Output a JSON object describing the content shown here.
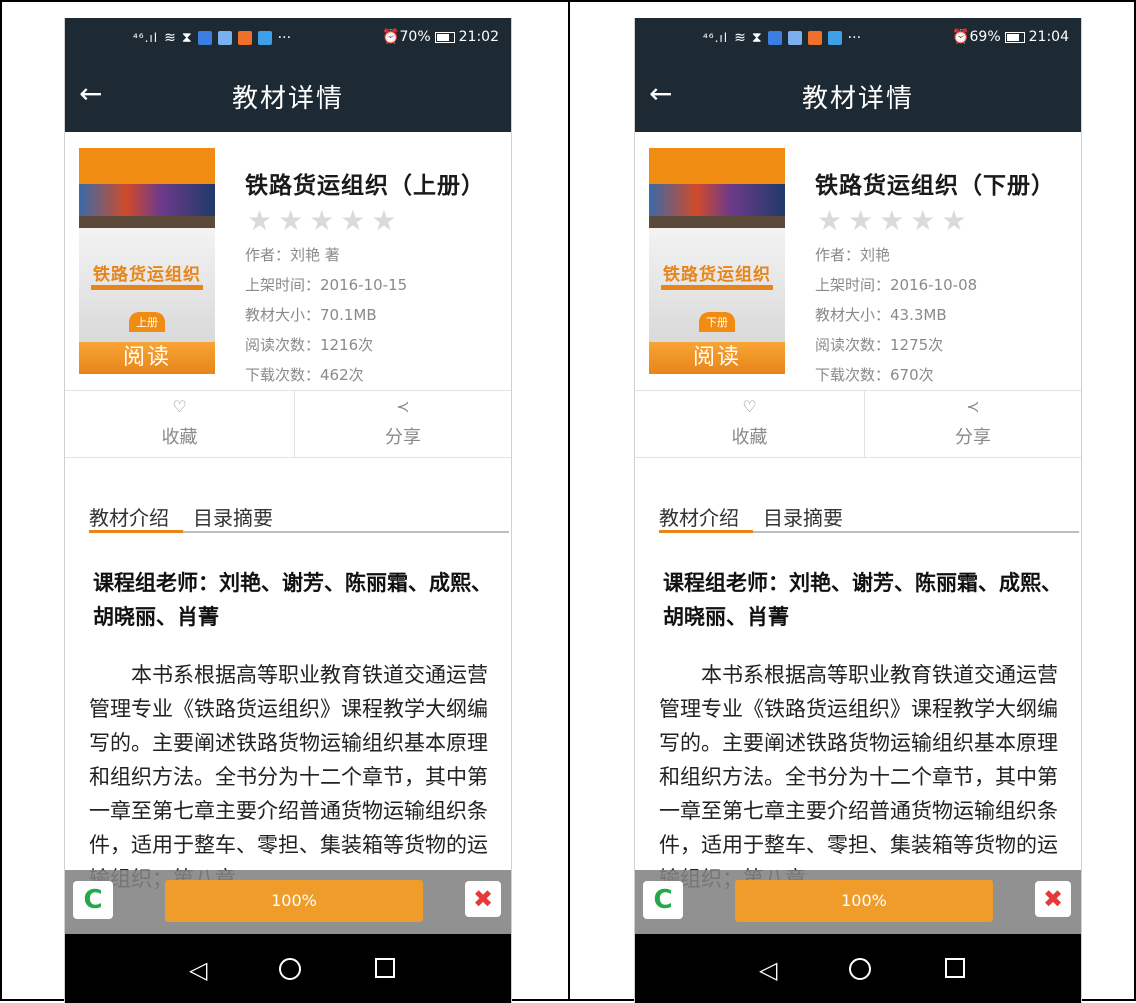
{
  "screens": [
    {
      "status": {
        "signal": "⁴⁶.ıl",
        "right": "70%",
        "time": "21:02"
      },
      "appbar": {
        "back": "←",
        "title": "教材详情"
      },
      "cover": {
        "title": "铁路货运组织",
        "volume": "上册"
      },
      "read_label": "阅读",
      "book": {
        "title": "铁路货运组织（上册）",
        "rating_stars": "★★★★★",
        "rating_filled": 0,
        "author": "作者：刘艳 著",
        "shelf_date": "上架时间：2016-10-15",
        "size": "教材大小：70.1MB",
        "reads": "阅读次数：1216次",
        "downloads": "下载次数：462次"
      },
      "actions": {
        "fav_icon": "♡",
        "fav": "收藏",
        "share_icon": "≺",
        "share": "分享"
      },
      "tabs": {
        "intro": "教材介绍",
        "toc": "目录摘要"
      },
      "heading": "课程组老师：刘艳、谢芳、陈丽霜、成熙、胡晓丽、肖菁",
      "intro_text": "本书系根据高等职业教育铁道交通运营管理专业《铁路货运组织》课程教学大纲编写的。主要阐述铁路货物运输组织基本原理和组织方法。全书分为十二个章节，其中第一章至第七章主要介绍普通货物运输组织条件，适用于整车、零担、集装箱等货物的运输组织；第八章",
      "download": {
        "refresh_icon": "C",
        "progress": "100%",
        "close_icon": "✖"
      },
      "nav": {
        "back": "◁",
        "home": "○",
        "recent": "□"
      }
    },
    {
      "status": {
        "signal": "⁴⁶.ıl",
        "right": "69%",
        "time": "21:04"
      },
      "appbar": {
        "back": "←",
        "title": "教材详情"
      },
      "cover": {
        "title": "铁路货运组织",
        "volume": "下册"
      },
      "read_label": "阅读",
      "book": {
        "title": "铁路货运组织（下册）",
        "rating_stars": "★★★★★",
        "rating_filled": 0,
        "author": "作者：刘艳",
        "shelf_date": "上架时间：2016-10-08",
        "size": "教材大小：43.3MB",
        "reads": "阅读次数：1275次",
        "downloads": "下载次数：670次"
      },
      "actions": {
        "fav_icon": "♡",
        "fav": "收藏",
        "share_icon": "≺",
        "share": "分享"
      },
      "tabs": {
        "intro": "教材介绍",
        "toc": "目录摘要"
      },
      "heading": "课程组老师：刘艳、谢芳、陈丽霜、成熙、胡晓丽、肖菁",
      "intro_text": "本书系根据高等职业教育铁道交通运营管理专业《铁路货运组织》课程教学大纲编写的。主要阐述铁路货物运输组织基本原理和组织方法。全书分为十二个章节，其中第一章至第七章主要介绍普通货物运输组织条件，适用于整车、零担、集装箱等货物的运输组织；第八章",
      "download": {
        "refresh_icon": "C",
        "progress": "100%",
        "close_icon": "✖"
      },
      "nav": {
        "back": "◁",
        "home": "○",
        "recent": "□"
      }
    }
  ],
  "colors": {
    "appbar": "#1e2a33",
    "accent": "#e8851a",
    "star_empty": "#dadada",
    "refresh": "#23a84a",
    "close": "#e53a3a"
  }
}
